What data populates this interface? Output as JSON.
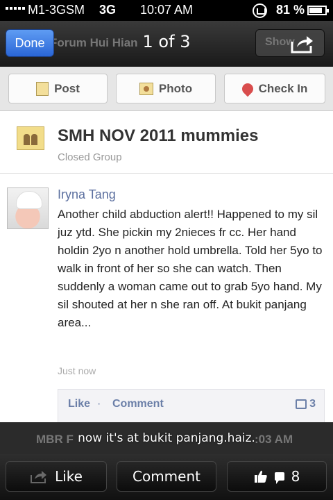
{
  "status_bar": {
    "carrier": "M1-3GSM",
    "network": "3G",
    "time": "10:07 AM",
    "battery": "81 %",
    "battery_level": 0.81
  },
  "viewer": {
    "done_label": "Done",
    "counter": "1 of 3",
    "ghost_title": "Forum Hui Hian",
    "ghost_show": "Show"
  },
  "page": {
    "actions": [
      {
        "label": "Post",
        "icon": "post-icon"
      },
      {
        "label": "Photo",
        "icon": "photo-icon"
      },
      {
        "label": "Check In",
        "icon": "location-pin-icon"
      }
    ],
    "group": {
      "name": "SMH NOV 2011 mummies",
      "type": "Closed Group"
    },
    "post": {
      "author": "Iryna Tang",
      "text": "Another child abduction alert!! Happened to my sil juz ytd. She pickin my 2nieces fr cc. Her hand holdin 2yo n another hold umbrella. Told her 5yo to walk in front of her so she can watch. Then suddenly a woman came out to grab 5yo hand. My sil shouted at her n she ran off. At bukit panjang area...",
      "timestamp": "Just now",
      "like_label": "Like",
      "separator": "·",
      "comment_label": "Comment",
      "comment_count": "3"
    }
  },
  "caption": {
    "text": "now it's at bukit panjang.haiz.",
    "ghost_left": "MBR F",
    "ghost_right": ":03 AM"
  },
  "toolbar": {
    "like_label": "Like",
    "comment_label": "Comment",
    "count": "8"
  }
}
